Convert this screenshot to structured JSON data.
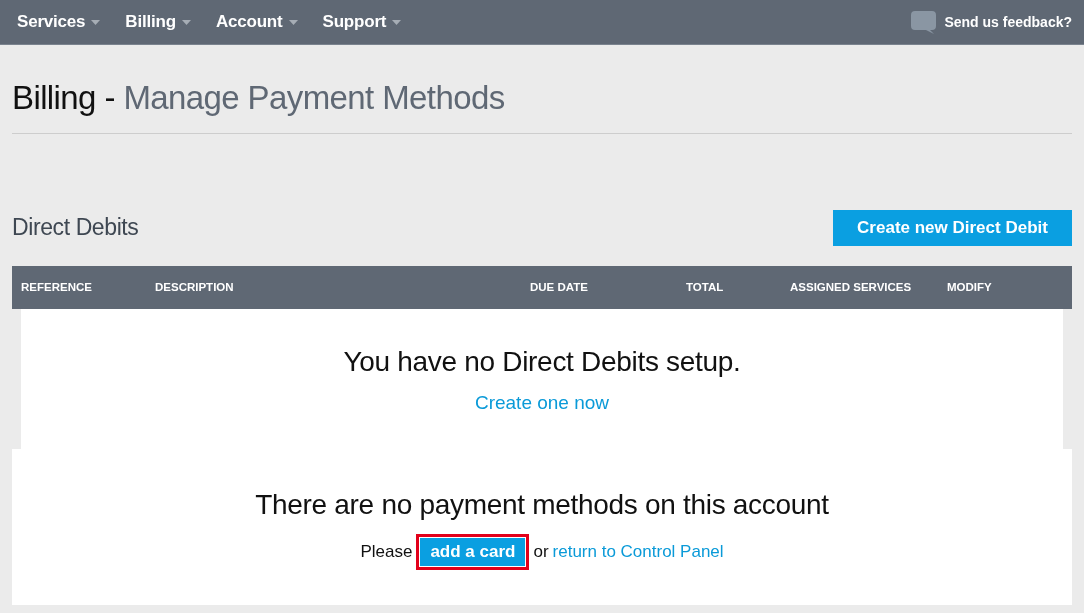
{
  "nav": {
    "items": [
      {
        "label": "Services"
      },
      {
        "label": "Billing"
      },
      {
        "label": "Account"
      },
      {
        "label": "Support"
      }
    ],
    "feedback": {
      "label": "Send us feedback?"
    }
  },
  "header": {
    "section": "Billing -",
    "title": "Manage Payment Methods"
  },
  "direct_debits": {
    "heading": "Direct Debits",
    "create_button": "Create new Direct Debit",
    "table": {
      "columns": [
        "REFERENCE",
        "DESCRIPTION",
        "DUE DATE",
        "TOTAL",
        "ASSIGNED SERVICES",
        "MODIFY"
      ]
    },
    "empty": {
      "message": "You have no Direct Debits setup.",
      "link": "Create one now"
    }
  },
  "payment_methods": {
    "message": "There are no payment methods on this account",
    "prompt": "Please",
    "add_card_button": {
      "label": "add a card",
      "highlighted": true
    },
    "conjunction": "or",
    "return_link": "return to Control Panel"
  }
}
